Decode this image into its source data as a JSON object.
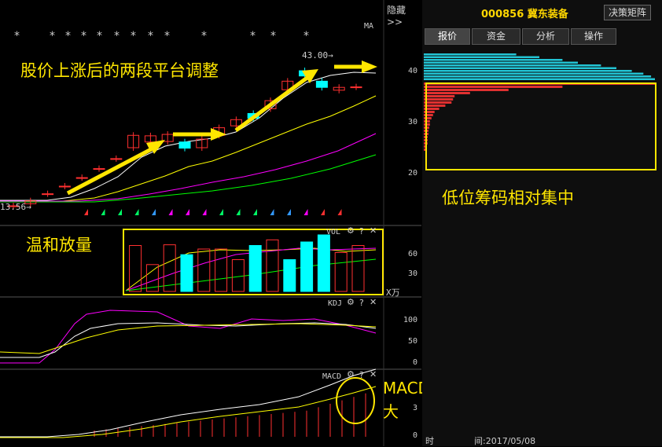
{
  "header": {
    "hide_label": "隐藏>>",
    "ma_label": "MA"
  },
  "stock": {
    "code_name": "000856 冀东装备",
    "decision_button": "决策矩阵"
  },
  "tabs": [
    {
      "label": "报价"
    },
    {
      "label": "资金"
    },
    {
      "label": "分析"
    },
    {
      "label": "操作"
    }
  ],
  "annotations": {
    "title": "股价上涨后的两段平台调整",
    "volume": "温和放量",
    "chips": "低位筹码相对集中",
    "macd_line1": "MACD维持金叉，红色立柱扩",
    "macd_line2": "大"
  },
  "price_labels": {
    "high": "43.00→",
    "low": "13.56→"
  },
  "panels": {
    "vol": {
      "label": "VOL",
      "ticks": [
        "60",
        "30"
      ],
      "unit": "X万"
    },
    "kdj": {
      "label": "KDJ",
      "ticks": [
        "100",
        "50",
        "0"
      ]
    },
    "macd": {
      "label": "MACD",
      "ticks": [
        "3",
        "0"
      ]
    }
  },
  "chip_axis": {
    "ticks": [
      "40",
      "30",
      "20"
    ]
  },
  "status": {
    "time_label": "时",
    "date_label": "间:2017/05/08"
  },
  "colors": {
    "up": "#ff3030",
    "down": "#00ffff",
    "ma5": "#ffffff",
    "ma10": "#ffff00",
    "ma20": "#ff00ff",
    "ma30": "#00ff00",
    "annotation": "#ffe600"
  },
  "chart_data": {
    "type": "candlestick",
    "candles": [
      {
        "o": 13.56,
        "c": 13.56
      },
      {
        "o": 14.0,
        "c": 14.6
      },
      {
        "o": 16.1,
        "c": 16.1
      },
      {
        "o": 17.7,
        "c": 17.7
      },
      {
        "o": 19.5,
        "c": 19.5
      },
      {
        "o": 21.4,
        "c": 21.4
      },
      {
        "o": 23.5,
        "c": 23.5
      },
      {
        "o": 25.8,
        "c": 28.4
      },
      {
        "o": 27.0,
        "c": 28.3
      },
      {
        "o": 27.1,
        "c": 28.6
      },
      {
        "o": 27.0,
        "c": 25.7
      },
      {
        "o": 25.8,
        "c": 27.6
      },
      {
        "o": 28.4,
        "c": 30.0
      },
      {
        "o": 30.4,
        "c": 31.7
      },
      {
        "o": 33.0,
        "c": 32.0
      },
      {
        "o": 34.0,
        "c": 35.7
      },
      {
        "o": 38.0,
        "c": 39.8
      },
      {
        "o": 42.0,
        "c": 40.9
      },
      {
        "o": 39.8,
        "c": 38.5
      },
      {
        "o": 37.9,
        "c": 38.5
      },
      {
        "o": 38.6,
        "c": 38.6
      }
    ],
    "volume": [
      null,
      null,
      null,
      null,
      null,
      null,
      null,
      65,
      38,
      66,
      52,
      60,
      60,
      45,
      65,
      73,
      45,
      70,
      80,
      55,
      65
    ],
    "volume_up": [
      true,
      true,
      true,
      true,
      true,
      true,
      true,
      true,
      true,
      true,
      false,
      true,
      true,
      true,
      false,
      true,
      false,
      false,
      false,
      true,
      true
    ]
  }
}
